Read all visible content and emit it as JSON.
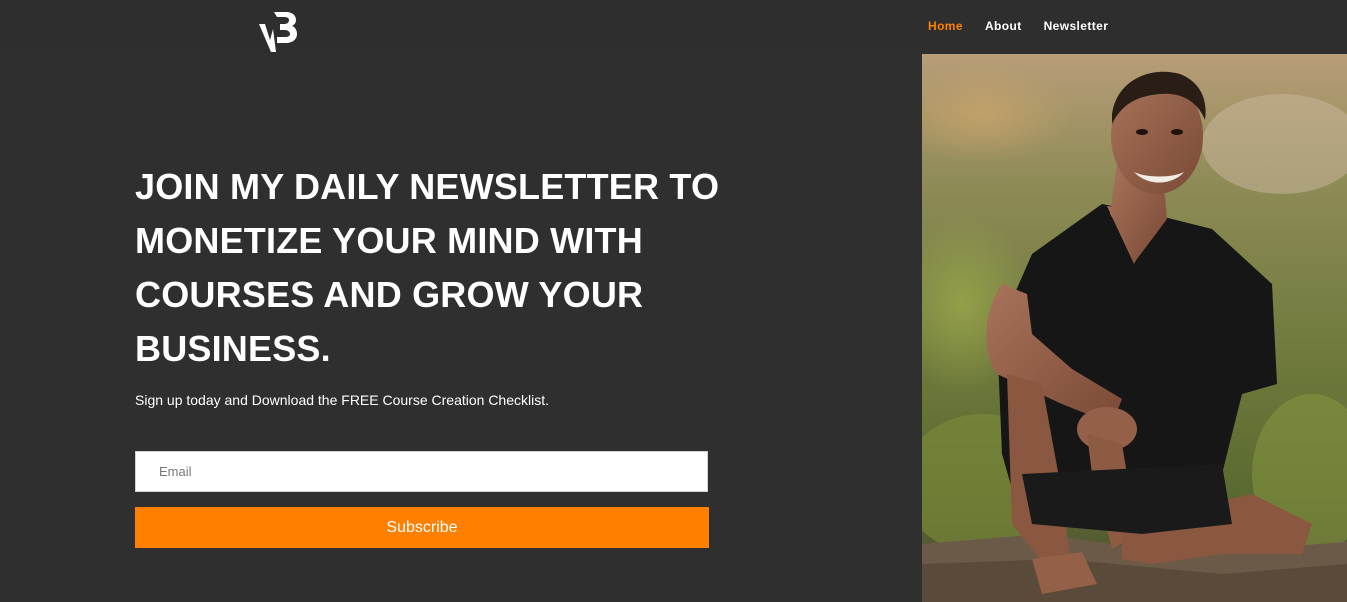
{
  "header": {
    "logo_text": "vB",
    "nav": [
      {
        "label": "Home",
        "active": true
      },
      {
        "label": "About",
        "active": false
      },
      {
        "label": "Newsletter",
        "active": false
      }
    ]
  },
  "hero": {
    "headline": "JOIN MY DAILY NEWSLETTER TO MONETIZE YOUR MIND WITH COURSES AND GROW YOUR BUSINESS.",
    "subtitle": "Sign up today and Download the FREE Course Creation Checklist.",
    "email_placeholder": "Email",
    "subscribe_label": "Subscribe"
  },
  "photo": {
    "subject": "smiling man in black t-shirt sitting outdoors"
  },
  "colors": {
    "background": "#2f2f2f",
    "accent": "#ff7f00",
    "text": "#ffffff"
  }
}
